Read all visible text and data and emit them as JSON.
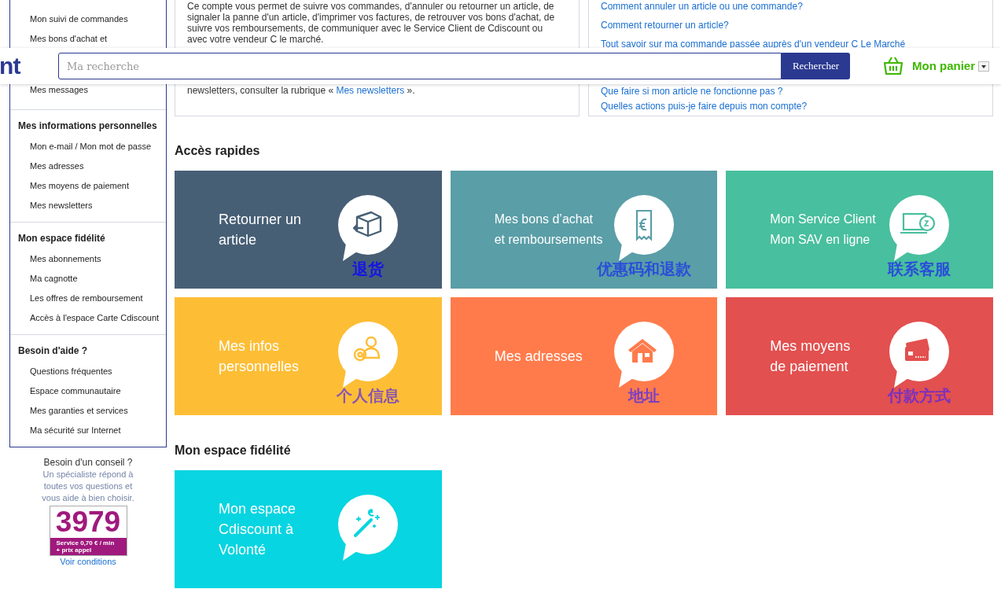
{
  "header": {
    "logo_text": "nt",
    "search": {
      "placeholder": "Ma recherche"
    },
    "search_button": "Rechercher",
    "cart_label": "Mon panier"
  },
  "sidebar": {
    "top_items": [
      "Mon suivi de commandes",
      "Mes bons d'achat et",
      "Mes messages"
    ],
    "sections": [
      {
        "title": "Mes informations personnelles",
        "items": [
          "Mon e-mail / Mon mot de passe",
          "Mes adresses",
          "Mes moyens de paiement",
          "Mes newsletters"
        ]
      },
      {
        "title": "Mon espace fidélité",
        "items": [
          "Mes abonnements",
          "Ma cagnotte",
          "Les offres de remboursement",
          "Accès à l'espace Carte Cdiscount"
        ]
      },
      {
        "title": "Besoin d'aide ?",
        "items": [
          "Questions fréquentes",
          "Espace communautaire",
          "Mes garanties et services",
          "Ma sécurité sur Internet"
        ]
      }
    ]
  },
  "advice": {
    "title": "Besoin d'un conseil ?",
    "text": "Un spécialiste répond à toutes vos questions et vous aide à bien choisir.",
    "phone": "3979",
    "price_lines": [
      "Service 0,70 € / min",
      "+ prix appel"
    ],
    "link": "Voir conditions"
  },
  "intro": {
    "paragraph": "Ce compte vous permet de suivre vos commandes, d'annuler ou retourner un article, de signaler la panne d'un article, d'imprimer vos factures, de retrouver vos bons d'achat, de suivre vos remboursements, de communiquer avec le Service Client de Cdiscount ou avec votre vendeur C le marché.",
    "newsletter_before": "newsletters, consulter la rubrique «",
    "newsletter_link": "Mes newsletters",
    "newsletter_after": "»."
  },
  "faq": {
    "links_above": [
      "Comment annuler un article ou une commande?",
      "Comment retourner un article?",
      "Tout savoir sur ma commande passée auprès d'un vendeur C Le Marché"
    ],
    "links_below": [
      "Que faire si mon article ne fonctionne pas ?",
      "Quelles actions puis-je faire depuis mon compte?"
    ]
  },
  "quick_access": {
    "title": "Accès rapides",
    "tiles": [
      {
        "lines": [
          "Retourner un",
          "article"
        ],
        "kind": "box",
        "color": "#475f75",
        "annotation": {
          "text": "退货",
          "color": "#1414e6"
        }
      },
      {
        "lines": [
          "Mes bons d’achat",
          "et remboursements"
        ],
        "kind": "voucher",
        "color": "#5a9ea7",
        "annotation": {
          "text": "优惠码和退款",
          "color": "#2a4ed8"
        }
      },
      {
        "lines": [
          "Mon Service Client",
          "Mon SAV en ligne"
        ],
        "kind": "computer",
        "color": "#48bf9e",
        "annotation": {
          "text": "联系客服",
          "color": "#2a4ed8"
        }
      },
      {
        "lines": [
          "Mes infos",
          "personnelles"
        ],
        "kind": "person",
        "color": "#fdbe36",
        "annotation": {
          "text": "个人信息",
          "color": "#8a55b0"
        }
      },
      {
        "lines": [
          "Mes adresses"
        ],
        "kind": "house",
        "color": "#ff7b4c",
        "annotation": {
          "text": "地址",
          "color": "#7a40c0"
        }
      },
      {
        "lines": [
          "Mes moyens",
          "de paiement"
        ],
        "kind": "card",
        "color": "#e2504f",
        "annotation": {
          "text": "付款方式",
          "color": "#7a30c0"
        }
      }
    ]
  },
  "fidelity": {
    "title": "Mon espace fidélité",
    "tiles": [
      {
        "lines": [
          "Mon espace",
          "Cdiscount à",
          "Volonté"
        ],
        "kind": "wand",
        "color": "#07d5e1"
      }
    ]
  }
}
